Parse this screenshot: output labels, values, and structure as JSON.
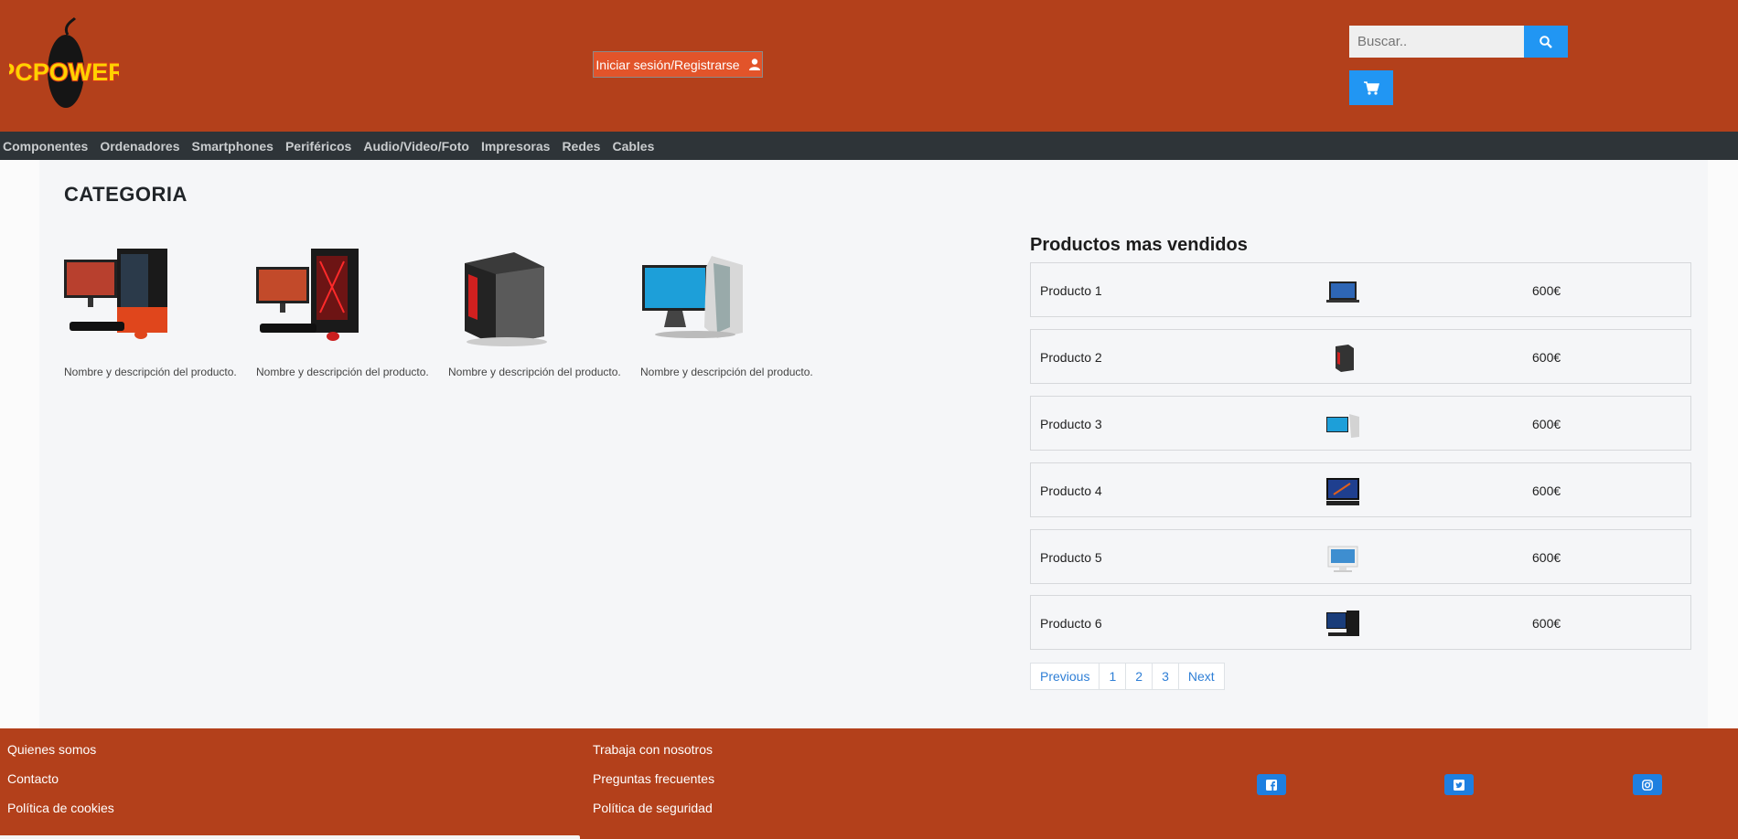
{
  "header": {
    "logo_text": "PCPOWER",
    "login_label": "Iniciar sesión/Registrarse",
    "search_placeholder": "Buscar..",
    "search_icon": "search-icon",
    "cart_icon": "cart-icon",
    "user_icon": "user-icon"
  },
  "nav": {
    "items": [
      "Componentes",
      "Ordenadores",
      "Smartphones",
      "Periféricos",
      "Audio/Video/Foto",
      "Impresoras",
      "Redes",
      "Cables"
    ]
  },
  "main": {
    "category_title": "CATEGORIA",
    "products": [
      {
        "description": "Nombre y descripción del producto."
      },
      {
        "description": "Nombre y descripción del producto."
      },
      {
        "description": "Nombre y descripción del producto."
      },
      {
        "description": "Nombre y descripción del producto."
      }
    ]
  },
  "best_sellers": {
    "title": "Productos mas vendidos",
    "items": [
      {
        "name": "Producto 1",
        "price": "600€"
      },
      {
        "name": "Producto 2",
        "price": "600€"
      },
      {
        "name": "Producto 3",
        "price": "600€"
      },
      {
        "name": "Producto 4",
        "price": "600€"
      },
      {
        "name": "Producto 5",
        "price": "600€"
      },
      {
        "name": "Producto 6",
        "price": "600€"
      }
    ],
    "pagination": [
      "Previous",
      "1",
      "2",
      "3",
      "Next"
    ]
  },
  "footer": {
    "col1": [
      "Quienes somos",
      "Contacto",
      "Política de cookies"
    ],
    "col2": [
      "Trabaja con nosotros",
      "Preguntas frecuentes",
      "Política de seguridad"
    ],
    "social_icons": [
      "facebook-icon",
      "twitter-icon",
      "instagram-icon"
    ]
  },
  "colors": {
    "brand": "#b3401b",
    "nav": "#2e3438",
    "accent_button": "#e2542a",
    "blue": "#2196f3"
  }
}
